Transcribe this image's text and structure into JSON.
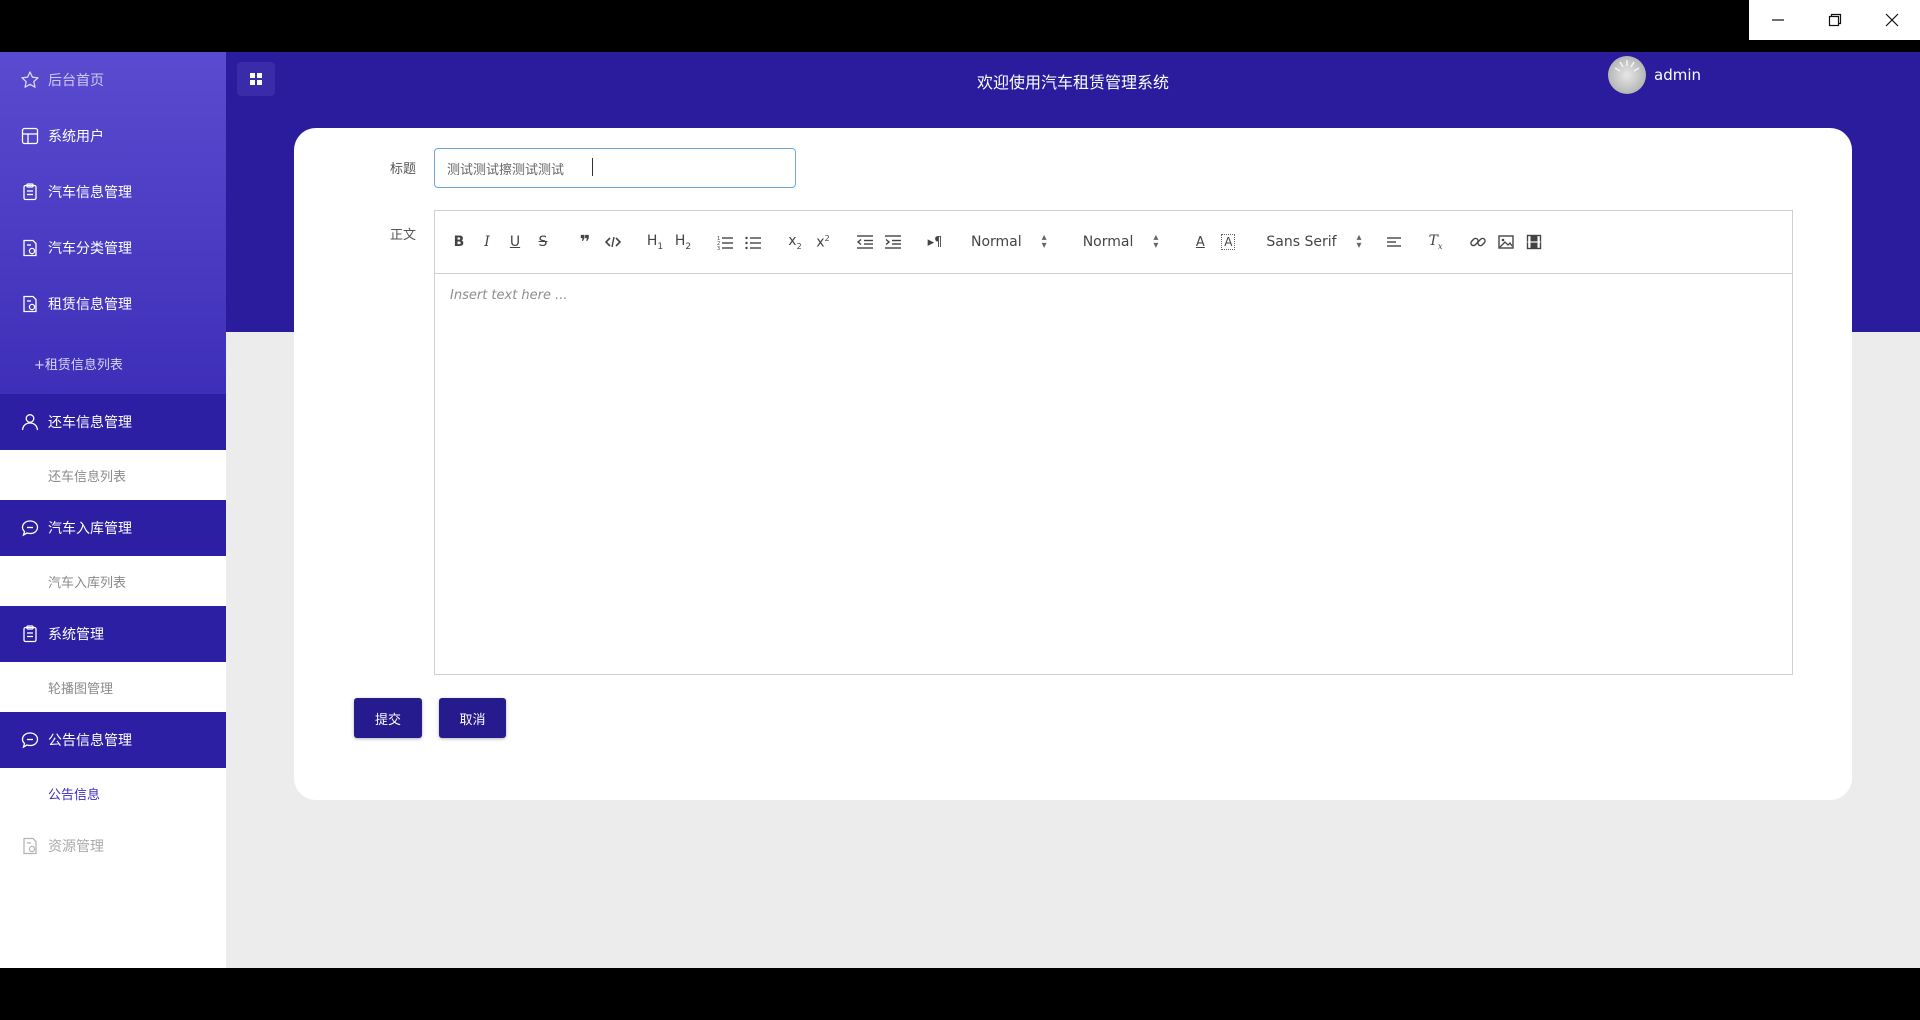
{
  "window": {
    "controls": [
      "minimize",
      "restore",
      "close"
    ]
  },
  "header": {
    "title": "欢迎使用汽车租赁管理系统",
    "username": "admin"
  },
  "sidebar": {
    "items": [
      {
        "label": "后台首页",
        "icon": "star-icon"
      },
      {
        "label": "系统用户",
        "icon": "grid-icon"
      },
      {
        "label": "汽车信息管理",
        "icon": "clipboard-icon"
      },
      {
        "label": "汽车分类管理",
        "icon": "doc-gear-icon"
      },
      {
        "label": "租赁信息管理",
        "icon": "doc-gear-icon"
      },
      {
        "label": "+租赁信息列表"
      },
      {
        "label": "还车信息管理",
        "icon": "user-icon"
      },
      {
        "label": "还车信息列表"
      },
      {
        "label": "汽车入库管理",
        "icon": "chat-icon"
      },
      {
        "label": "汽车入库列表"
      },
      {
        "label": "系统管理",
        "icon": "clipboard-icon"
      },
      {
        "label": "轮播图管理"
      },
      {
        "label": "公告信息管理",
        "icon": "chat-icon"
      },
      {
        "label": "公告信息"
      },
      {
        "label": "资源管理",
        "icon": "doc-gear-icon"
      }
    ]
  },
  "form": {
    "title_label": "标题",
    "title_value": "测试测试擦测试测试",
    "body_label": "正文",
    "body_placeholder": "Insert text here ...",
    "submit_label": "提交",
    "cancel_label": "取消"
  },
  "toolbar": {
    "header_select": "Normal",
    "size_select": "Normal",
    "font_select": "Sans Serif"
  },
  "colors": {
    "primary": "#2a1c9c",
    "sidebar_top": "#5a4bd0",
    "button": "#261a8f",
    "active_sub": "#3d2bbf"
  }
}
